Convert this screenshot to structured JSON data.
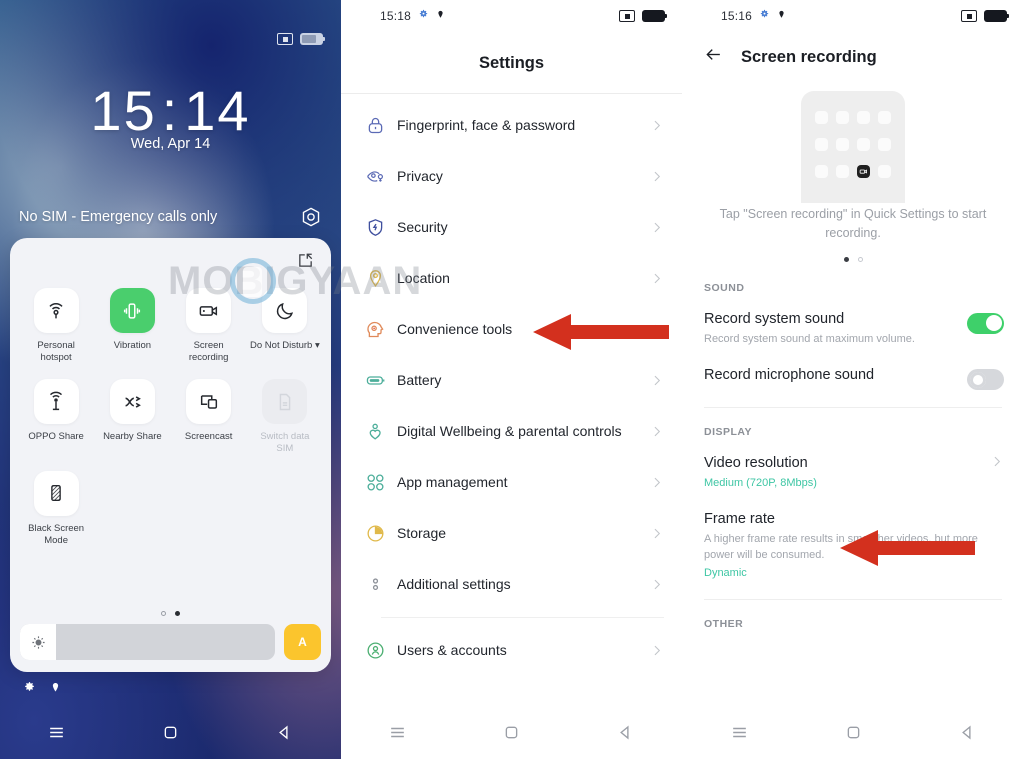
{
  "lockscreen": {
    "statusbar": {
      "cast_icon": "cast-icon",
      "battery_icon": "battery-icon"
    },
    "time_hours": "15",
    "time_colon": ":",
    "time_minutes": "14",
    "date": "Wed, Apr 14",
    "sim_status": "No SIM - Emergency calls only",
    "camera_icon": "camera-shortcut-icon",
    "quick_settings": {
      "edit_icon": "edit-icon",
      "tiles": [
        {
          "label": "Personal\nhotspot",
          "icon": "personal-hotspot-icon",
          "state": "off"
        },
        {
          "label": "Vibration",
          "icon": "vibration-icon",
          "state": "on"
        },
        {
          "label": "Screen\nrecording",
          "icon": "screen-recording-icon",
          "state": "off"
        },
        {
          "label": "Do Not Disturb ▾",
          "icon": "do-not-disturb-icon",
          "state": "off"
        },
        {
          "label": "OPPO Share",
          "icon": "oppo-share-icon",
          "state": "off"
        },
        {
          "label": "Nearby Share",
          "icon": "nearby-share-icon",
          "state": "off"
        },
        {
          "label": "Screencast",
          "icon": "screencast-icon",
          "state": "off"
        },
        {
          "label": "Switch data\nSIM",
          "icon": "sim-card-icon",
          "state": "disabled"
        },
        {
          "label": "Black Screen\nMode",
          "icon": "black-screen-mode-icon",
          "state": "off"
        }
      ],
      "page_dots": [
        "hollow",
        "solid"
      ],
      "brightness": {
        "icon": "brightness-icon",
        "auto_label": "A",
        "auto_color": "#fbc52d"
      }
    },
    "bottom_icons": [
      "settings-gear-icon",
      "location-pin-icon"
    ],
    "navbar": [
      "recents-icon",
      "home-icon",
      "back-icon"
    ]
  },
  "settings": {
    "statusbar": {
      "time": "15:18",
      "gear_icon": "gear-icon",
      "location_icon": "location-pin-icon",
      "cast_icon": "cast-icon",
      "battery_icon": "battery-icon"
    },
    "title": "Settings",
    "items": [
      {
        "label": "Fingerprint, face & password",
        "icon": "lock-icon",
        "color": "#5b6ab5"
      },
      {
        "label": "Privacy",
        "icon": "privacy-eye-icon",
        "color": "#5b6ab5"
      },
      {
        "label": "Security",
        "icon": "security-shield-icon",
        "color": "#3f4f9e"
      },
      {
        "label": "Location",
        "icon": "location-pin-icon",
        "color": "#e0b94a"
      },
      {
        "label": "Convenience tools",
        "icon": "convenience-tools-icon",
        "color": "#e08a5a"
      },
      {
        "label": "Battery",
        "icon": "battery-icon",
        "color": "#4cae9a"
      },
      {
        "label": "Digital Wellbeing & parental controls",
        "icon": "wellbeing-icon",
        "color": "#4cae9a"
      },
      {
        "label": "App management",
        "icon": "app-management-icon",
        "color": "#4cae9a"
      },
      {
        "label": "Storage",
        "icon": "storage-pie-icon",
        "color": "#e0b94a"
      },
      {
        "label": "Additional settings",
        "icon": "additional-settings-icon",
        "color": "#8d9199"
      },
      {
        "label": "Users & accounts",
        "icon": "users-accounts-icon",
        "color": "#4caf72"
      }
    ],
    "chevron_icon": "chevron-right-icon",
    "navbar": [
      "recents-icon",
      "home-icon",
      "back-icon"
    ]
  },
  "screen_recording": {
    "statusbar": {
      "time": "15:16",
      "gear_icon": "gear-icon",
      "location_icon": "location-pin-icon",
      "cast_icon": "cast-icon",
      "battery_icon": "battery-icon"
    },
    "back_icon": "back-arrow-icon",
    "title": "Screen recording",
    "hero": {
      "mock_icon": "phone-quick-settings-mock",
      "record_tile_icon": "screen-recording-icon"
    },
    "hint": "Tap \"Screen recording\" in Quick Settings to start recording.",
    "page_dots": [
      "solid",
      "hollow"
    ],
    "sections": [
      {
        "header": "SOUND",
        "rows": [
          {
            "title": "Record system sound",
            "subtitle": "Record system sound at maximum volume.",
            "control": "toggle",
            "state": "on"
          },
          {
            "title": "Record microphone sound",
            "subtitle": "",
            "control": "toggle",
            "state": "off"
          }
        ]
      },
      {
        "header": "DISPLAY",
        "rows": [
          {
            "title": "Video resolution",
            "subtitle": "",
            "value": "Medium (720P, 8Mbps)",
            "control": "chevron"
          },
          {
            "title": "Frame rate",
            "subtitle": "A higher frame rate results in smoother videos, but more power will be consumed.",
            "value": "Dynamic",
            "control": "none"
          }
        ]
      },
      {
        "header": "OTHER",
        "rows": []
      }
    ],
    "chevron_icon": "chevron-right-icon",
    "navbar": [
      "recents-icon",
      "home-icon",
      "back-icon"
    ]
  },
  "annotations": {
    "arrows": [
      {
        "name": "arrow-convenience-tools",
        "color": "#d3301e"
      },
      {
        "name": "arrow-video-resolution",
        "color": "#d3301e"
      }
    ]
  },
  "watermark": {
    "text": "MOBIGYAAN"
  }
}
